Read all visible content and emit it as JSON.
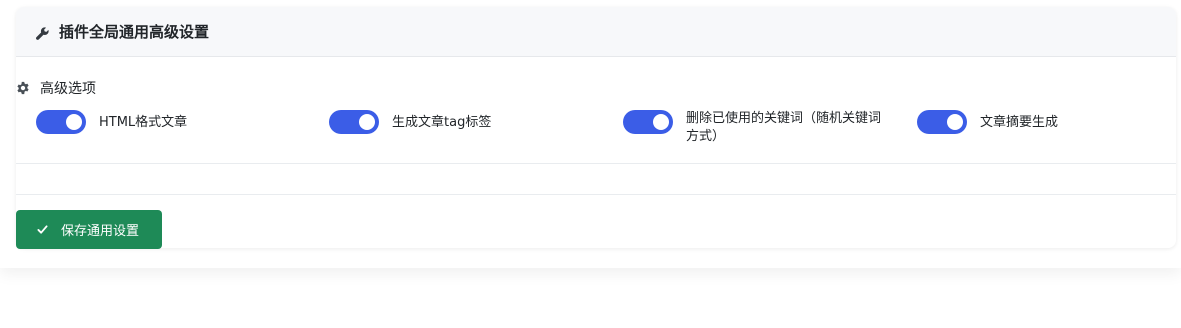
{
  "header": {
    "title": "插件全局通用高级设置",
    "icon": "wrench-icon"
  },
  "section": {
    "title": "高级选项",
    "icon": "gear-icon"
  },
  "toggles": [
    {
      "label": "HTML格式文章",
      "on": true
    },
    {
      "label": "生成文章tag标签",
      "on": true
    },
    {
      "label": "删除已使用的关键词（随机关键词方式）",
      "on": true
    },
    {
      "label": "文章摘要生成",
      "on": true
    }
  ],
  "save_button": {
    "label": "保存通用设置",
    "icon": "check-icon"
  },
  "colors": {
    "toggle_on": "#3b5de7",
    "save_button": "#1e8a57",
    "header_bg": "#f7f8fa"
  }
}
